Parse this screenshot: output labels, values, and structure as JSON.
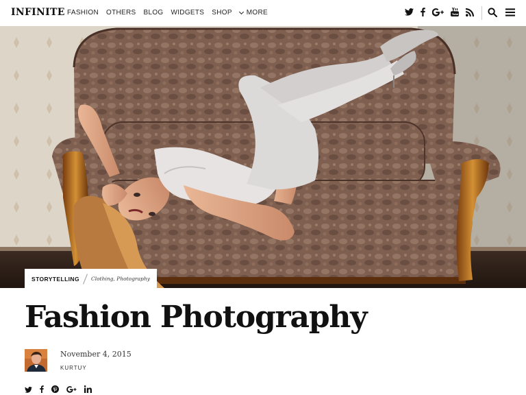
{
  "header": {
    "logo": "INFINITE",
    "nav": {
      "fashion": "FASHION",
      "others": "OTHERS",
      "blog": "BLOG",
      "widgets": "WIDGETS",
      "shop": "SHOP",
      "more": "MORE"
    },
    "social_icons": [
      "twitter-icon",
      "facebook-icon",
      "google-plus-icon",
      "youtube-icon",
      "rss-icon"
    ],
    "right_icons": [
      "search-icon",
      "hamburger-menu-icon"
    ]
  },
  "post": {
    "category": "STORYTELLING",
    "tags": "Clothing, Photography",
    "title": "Fashion Photography",
    "date": "November 4, 2015",
    "author": "KURTUY"
  },
  "share_icons": [
    "twitter-icon",
    "facebook-icon",
    "pinterest-icon",
    "google-plus-icon",
    "linkedin-icon"
  ],
  "colors": {
    "background": "#ffffff",
    "text": "#111111",
    "sofa": "#7a5a4a",
    "wood": "#b8741e",
    "wall": "#d9d2c4"
  }
}
